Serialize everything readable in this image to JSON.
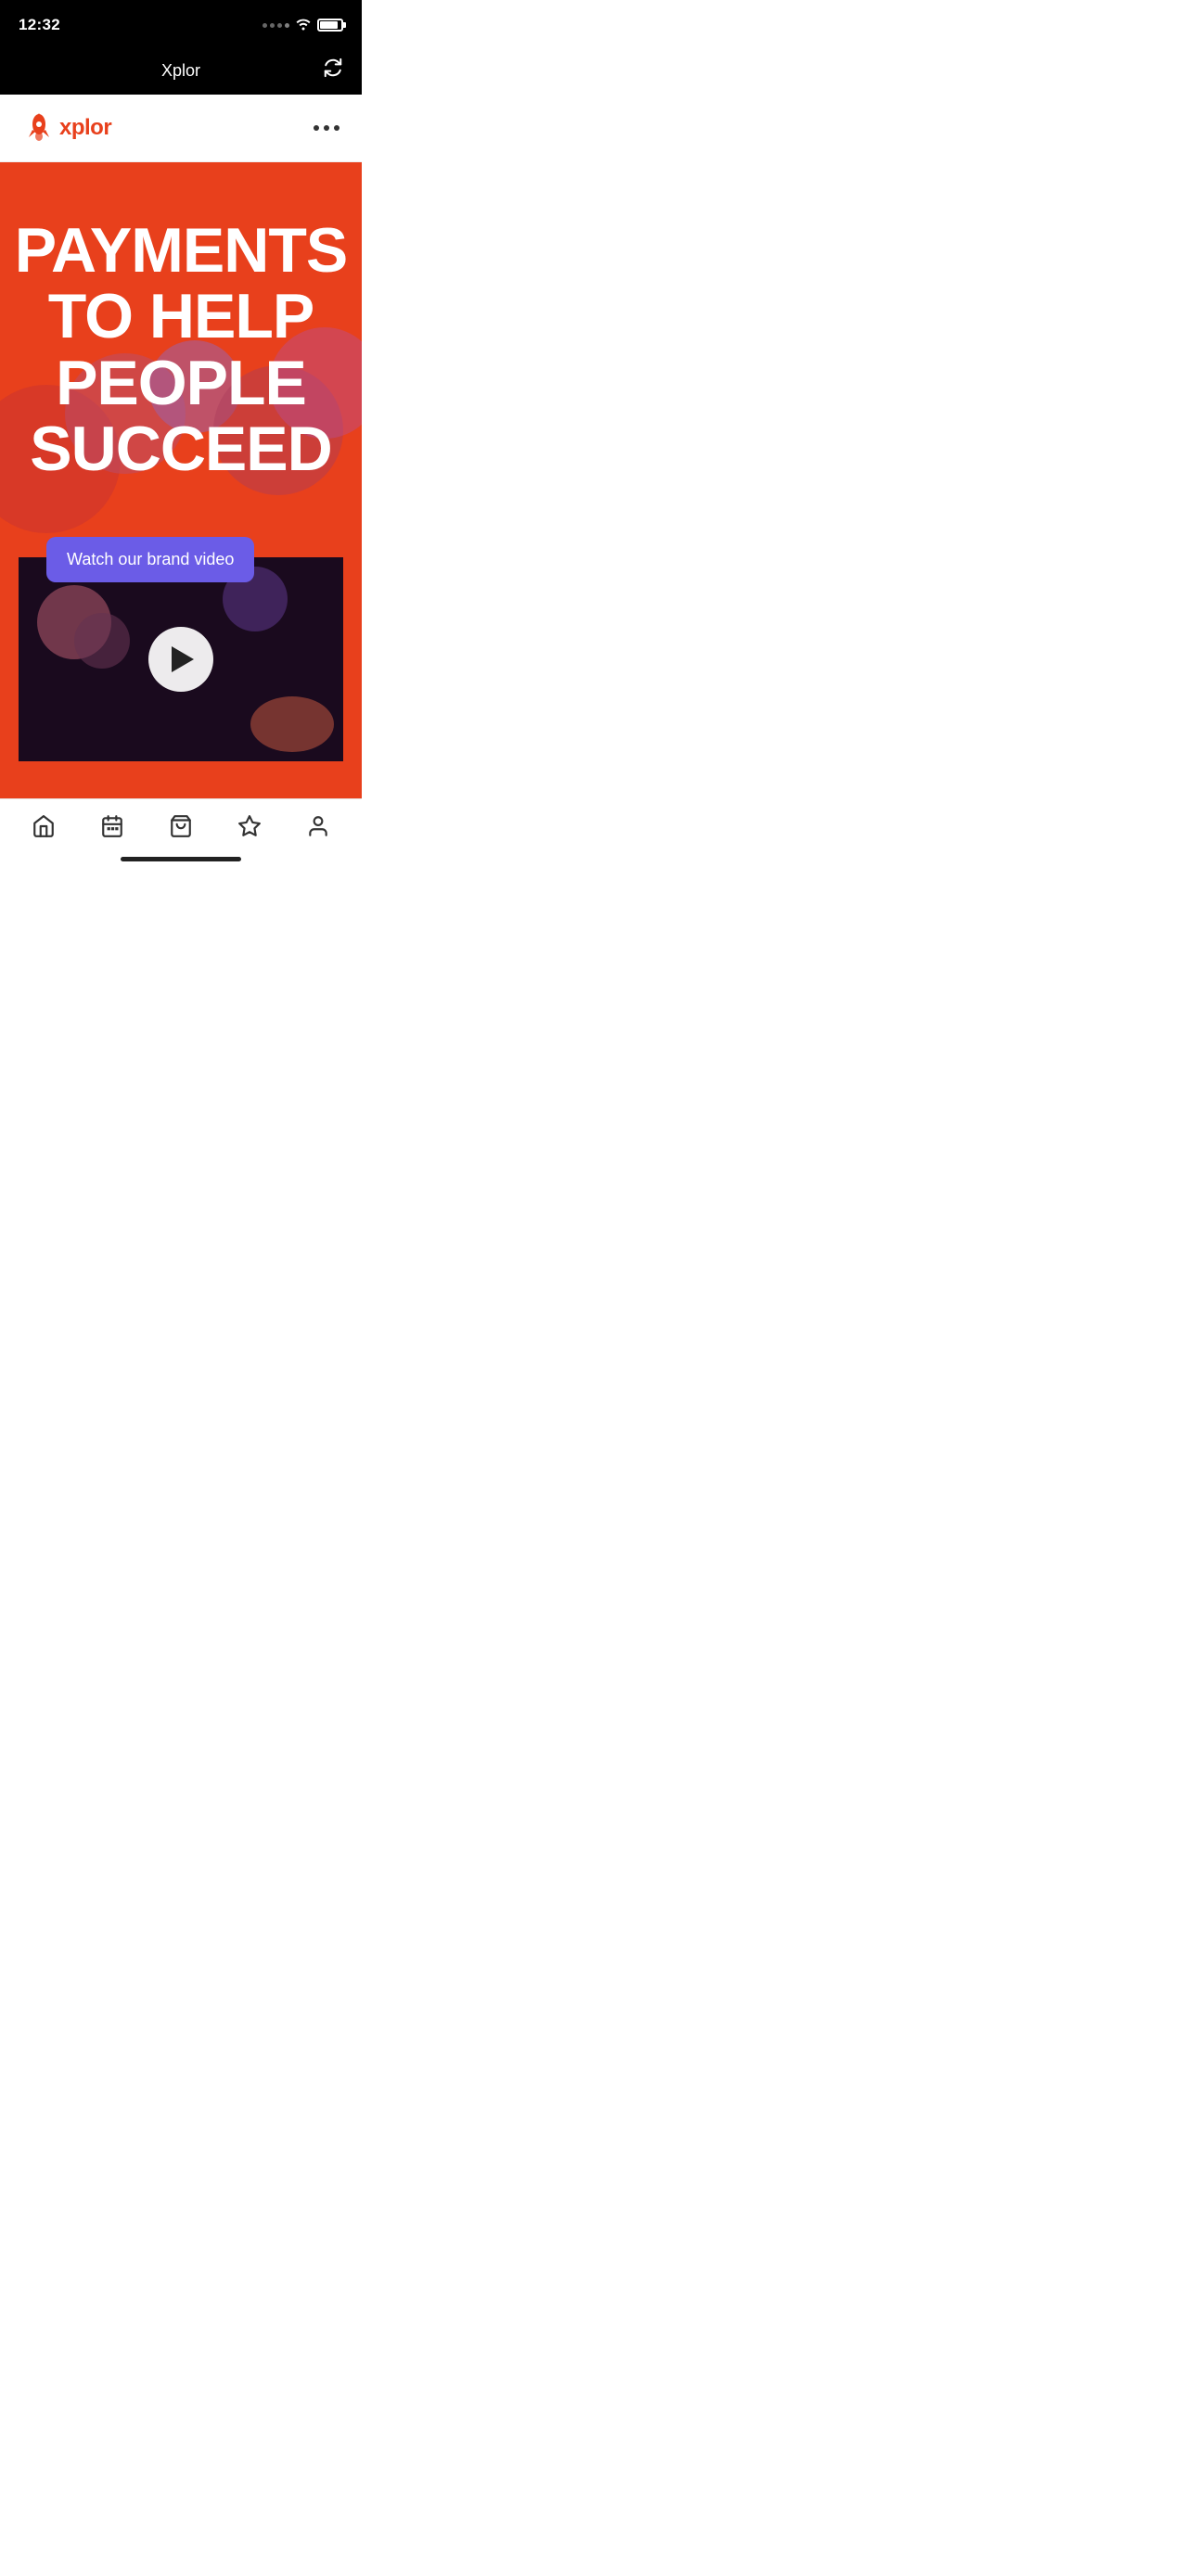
{
  "statusBar": {
    "time": "12:32"
  },
  "browserNav": {
    "title": "Xplor",
    "refreshLabel": "↺"
  },
  "appHeader": {
    "logoText": "xplor",
    "moreLabel": "···"
  },
  "hero": {
    "headline": "PAYMENTS TO HELP PEOPLE SUCCEED"
  },
  "video": {
    "label": "Watch our brand video",
    "playLabel": "▶"
  },
  "tabBar": {
    "tabs": [
      {
        "id": "home",
        "label": "Home"
      },
      {
        "id": "calendar",
        "label": "Calendar"
      },
      {
        "id": "shop",
        "label": "Shop"
      },
      {
        "id": "favorites",
        "label": "Favorites"
      },
      {
        "id": "profile",
        "label": "Profile"
      }
    ]
  },
  "colors": {
    "brand": "#E8401C",
    "purple": "#6B5CE7",
    "dark": "#1a0a1e"
  }
}
